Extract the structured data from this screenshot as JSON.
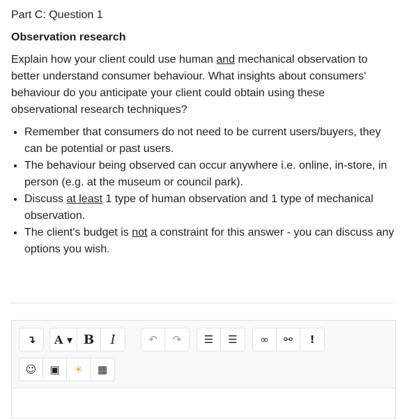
{
  "question": {
    "number_label": "Part C: Question 1",
    "title": "Observation research",
    "intro": {
      "part1": "Explain how your client could use human ",
      "underlined": "and",
      "part2": " mechanical observation to better understand consumer behaviour. What insights about consumers' behaviour do you anticipate your client could obtain using these observational research techniques?"
    },
    "bullets": [
      {
        "text": "Remember that consumers do not need to be current users/buyers, they can be potential or past users."
      },
      {
        "text": "The behaviour being observed can occur anywhere i.e. online, in-store, in person (e.g. at the museum or council park)."
      },
      {
        "before": "Discuss ",
        "underlined": "at least",
        "after": " 1 type of human observation and 1 type of mechanical observation."
      },
      {
        "before": "The client's budget is ",
        "underlined": "not",
        "after": " a constraint for this answer - you can discuss any options you wish."
      }
    ]
  },
  "toolbar": {
    "row1": [
      {
        "icon": "collapse-icon",
        "glyph": "↴"
      },
      {
        "icon": "font-style-icon",
        "glyph": "A ▾"
      },
      {
        "icon": "bold-icon",
        "glyph": "B"
      },
      {
        "icon": "italic-icon",
        "glyph": "I"
      },
      {
        "icon": "undo-icon",
        "glyph": "↶"
      },
      {
        "icon": "redo-icon",
        "glyph": "↷"
      },
      {
        "icon": "unordered-list-icon",
        "glyph": "☰"
      },
      {
        "icon": "ordered-list-icon",
        "glyph": "☰"
      },
      {
        "icon": "link-icon",
        "glyph": "∞"
      },
      {
        "icon": "unlink-icon",
        "glyph": "⚯"
      },
      {
        "icon": "accessibility-checker-icon",
        "glyph": "!"
      }
    ],
    "row2": [
      {
        "icon": "emoji-icon",
        "glyph": "☺"
      },
      {
        "icon": "image-icon",
        "glyph": "▣"
      },
      {
        "icon": "media-icon",
        "glyph": "✳"
      },
      {
        "icon": "table-icon",
        "glyph": "▦"
      }
    ],
    "colors": {
      "toolbar_bg": "#f8f9fa",
      "border": "#dee2e6",
      "media_icon": "#e8a33b"
    }
  }
}
